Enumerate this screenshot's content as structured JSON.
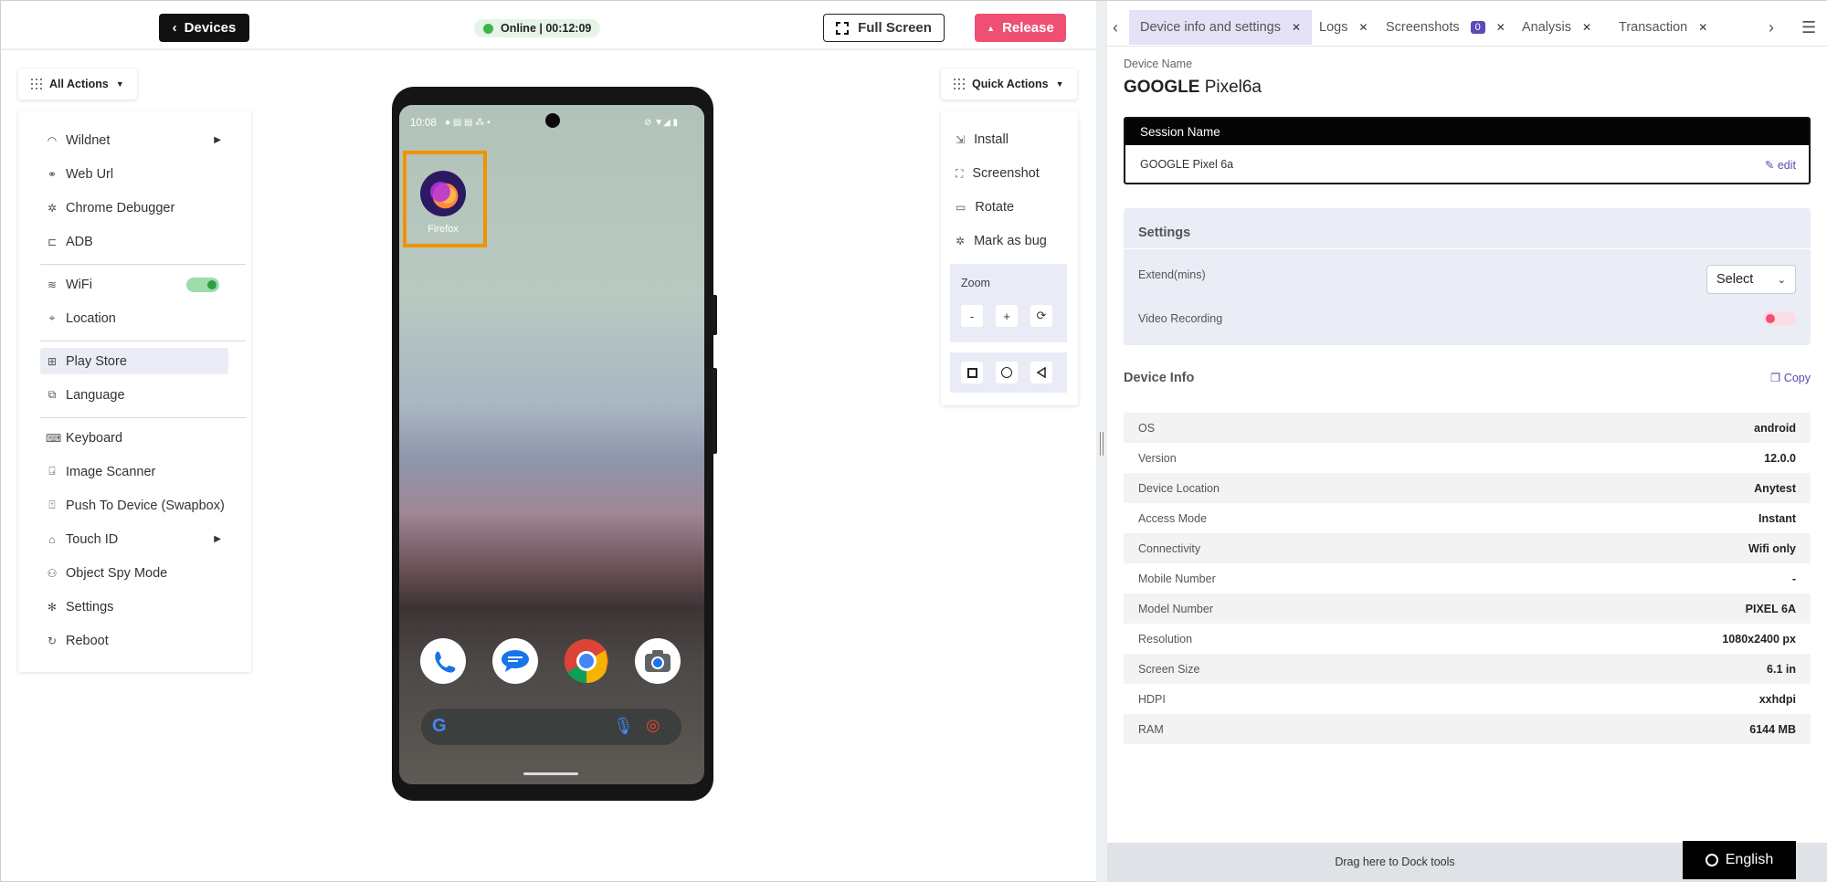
{
  "topbar": {
    "devices_label": "Devices",
    "status_text": "Online | 00:12:09",
    "fullscreen_label": "Full Screen",
    "release_label": "Release"
  },
  "all_actions": {
    "label": "All Actions",
    "items": {
      "wildnet": "Wildnet",
      "web_url": "Web Url",
      "chrome_debugger": "Chrome Debugger",
      "adb": "ADB",
      "wifi": "WiFi",
      "location": "Location",
      "play_store": "Play Store",
      "language": "Language",
      "keyboard": "Keyboard",
      "image_scanner": "Image Scanner",
      "push_to_device": "Push To Device (Swapbox)",
      "touch_id": "Touch ID",
      "object_spy": "Object Spy Mode",
      "settings": "Settings",
      "reboot": "Reboot"
    },
    "wifi_enabled": true
  },
  "phone": {
    "time": "10:08",
    "app_label": "Firefox",
    "highlight_color": "#f39200"
  },
  "quick_actions": {
    "label": "Quick Actions",
    "install": "Install",
    "screenshot": "Screenshot",
    "rotate": "Rotate",
    "mark_as_bug": "Mark as bug",
    "zoom_label": "Zoom",
    "zoom_minus": "-",
    "zoom_plus": "+"
  },
  "tabs": {
    "device_info": "Device info and settings",
    "logs": "Logs",
    "screenshots": "Screenshots",
    "screenshots_count": "0",
    "analysis": "Analysis",
    "transaction": "Transaction"
  },
  "device": {
    "name_label": "Device Name",
    "brand": "GOOGLE",
    "model": "Pixel6a",
    "session_name_label": "Session Name",
    "session_name": "GOOGLE Pixel 6a",
    "edit_label": "edit"
  },
  "settings": {
    "title": "Settings",
    "extend_label": "Extend(mins)",
    "extend_value": "Select",
    "video_label": "Video Recording",
    "video_enabled": false
  },
  "device_info": {
    "title": "Device Info",
    "copy_label": "Copy",
    "rows": [
      {
        "key": "OS",
        "value": "android"
      },
      {
        "key": "Version",
        "value": "12.0.0"
      },
      {
        "key": "Device Location",
        "value": "Anytest"
      },
      {
        "key": "Access Mode",
        "value": "Instant"
      },
      {
        "key": "Connectivity",
        "value": "Wifi only"
      },
      {
        "key": "Mobile Number",
        "value": "-"
      },
      {
        "key": "Model Number",
        "value": "PIXEL 6A"
      },
      {
        "key": "Resolution",
        "value": "1080x2400 px"
      },
      {
        "key": "Screen Size",
        "value": "6.1 in"
      },
      {
        "key": "HDPI",
        "value": "xxhdpi"
      },
      {
        "key": "RAM",
        "value": "6144 MB"
      }
    ]
  },
  "footer": {
    "dock_text": "Drag here to Dock tools",
    "language_label": "English"
  },
  "colors": {
    "release": "#ee4f73",
    "online": "#3cb54a",
    "accent": "#5b4bb7",
    "active_tab": "#e3e2f7"
  }
}
